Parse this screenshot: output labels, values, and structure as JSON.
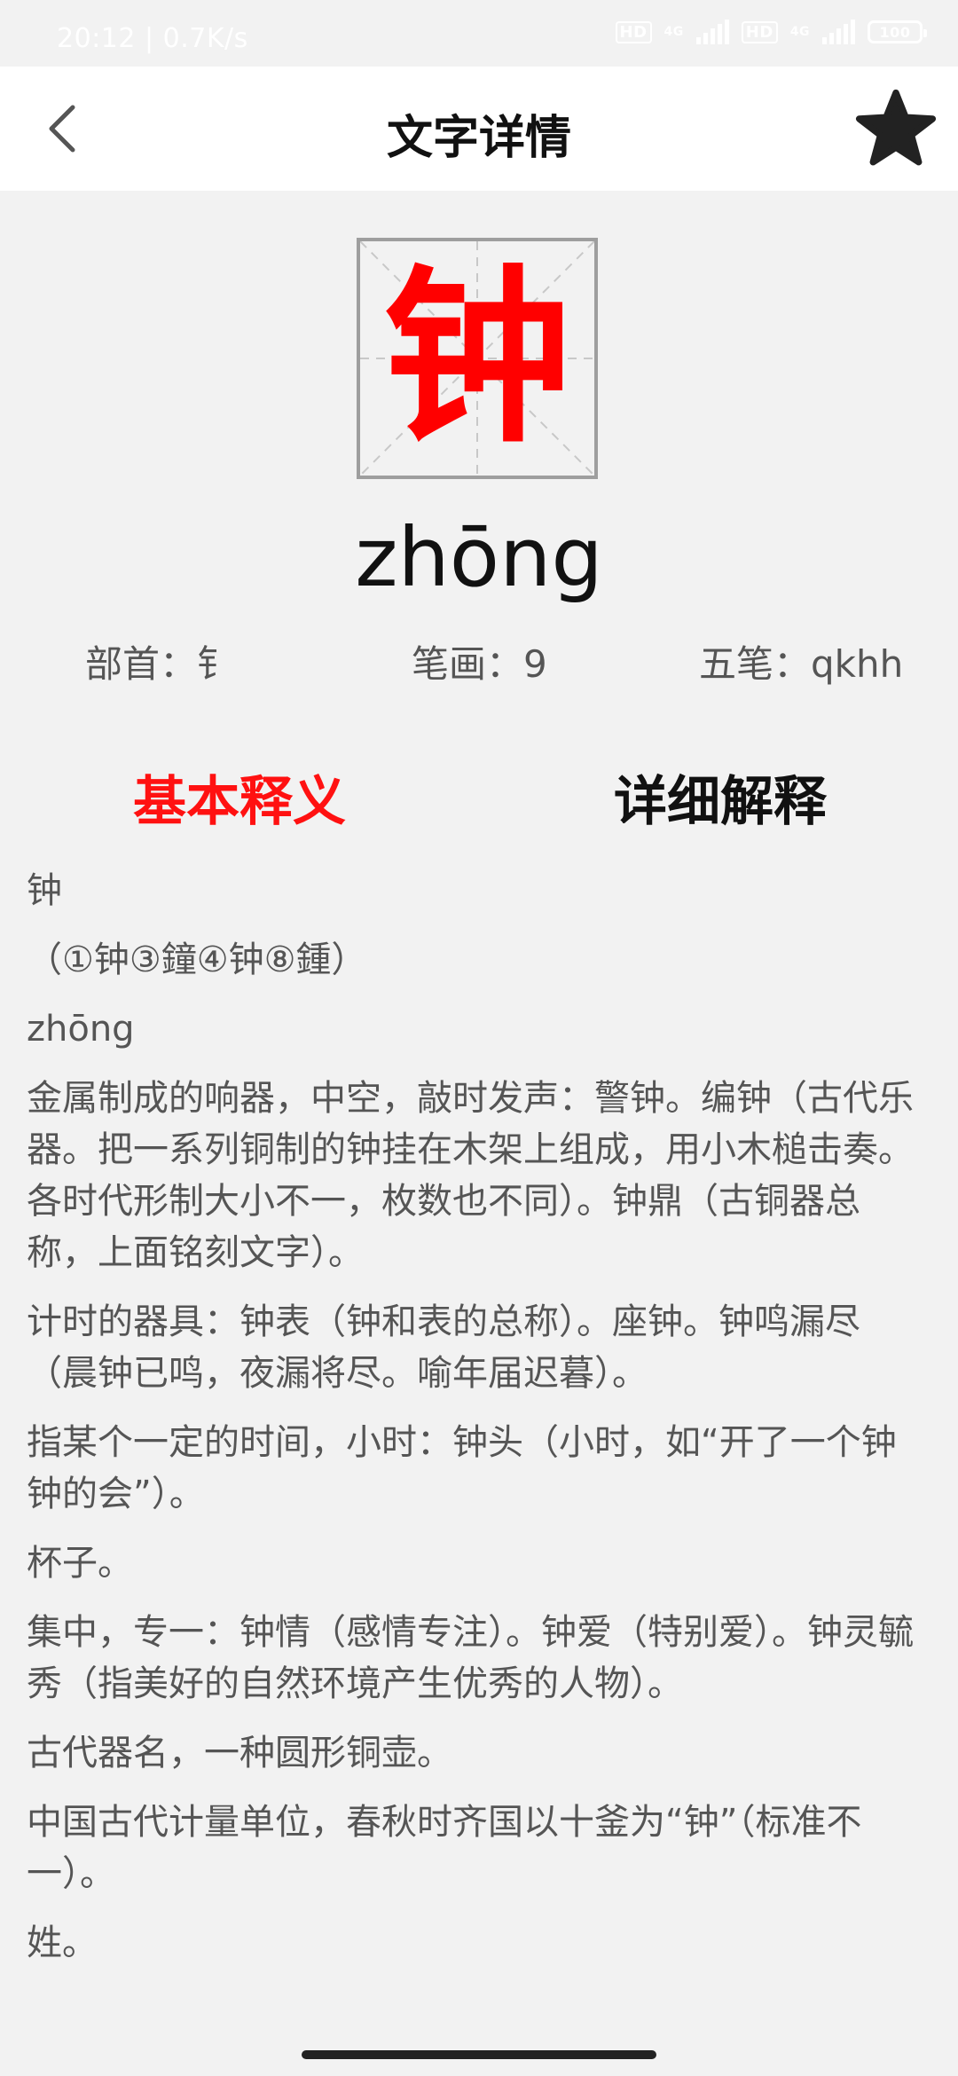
{
  "statusbar": {
    "time": "20:12 | 0.7K/s",
    "sim1_label": "HD",
    "sim1_network": "4G",
    "sim2_label": "HD",
    "sim2_network": "4G",
    "battery": "100"
  },
  "header": {
    "title": "文字详情",
    "back_icon": "chevron-left-icon",
    "favorite_icon": "star-icon"
  },
  "character": {
    "glyph": "钟",
    "color": "#ff0000",
    "pinyin": "zhōng"
  },
  "meta": {
    "radical": "部首：钅",
    "strokes": "笔画：9",
    "wubi": "五笔：qkhh"
  },
  "tabs": [
    {
      "label": "基本释义",
      "active": true,
      "color": "#ff1111"
    },
    {
      "label": "详细解释",
      "active": false
    }
  ],
  "definition": [
    "钟",
    "（①钟③鐘④钟⑧鍾）",
    "zhōng",
    "金属制成的响器，中空，敲时发声：警钟。编钟（古代乐器。把一系列铜制的钟挂在木架上组成，用小木槌击奏。各时代形制大小不一，枚数也不同）。钟鼎（古铜器总称，上面铭刻文字）。",
    "计时的器具：钟表（钟和表的总称）。座钟。钟鸣漏尽（晨钟已鸣，夜漏将尽。喻年届迟暮）。",
    "指某个一定的时间，小时：钟头（小时，如“开了一个钟钟的会”）。",
    "杯子。",
    "集中，专一：钟情（感情专注）。钟爱（特别爱）。钟灵毓秀（指美好的自然环境产生优秀的人物）。",
    "古代器名，一种圆形铜壶。",
    "中国古代计量单位，春秋时齐国以十釜为“钟”（标准不一）。",
    "姓。"
  ]
}
